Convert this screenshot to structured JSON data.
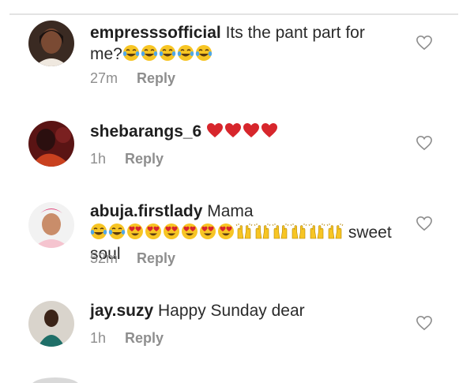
{
  "comments": [
    {
      "username": "empresssofficial",
      "text_before": " Its the pant part for me?",
      "text_after": "",
      "time": "27m",
      "reply_label": "Reply",
      "emojis": [
        "tears-of-joy",
        "tears-of-joy",
        "tears-of-joy",
        "tears-of-joy",
        "tears-of-joy"
      ]
    },
    {
      "username": "shebarangs_6",
      "text_before": "",
      "text_after": "",
      "time": "1h",
      "reply_label": "Reply",
      "emojis": [
        "red-heart",
        "red-heart",
        "red-heart",
        "red-heart"
      ]
    },
    {
      "username": "abuja.firstlady",
      "text_before": " Mama",
      "text_after": " sweet soul",
      "time": "52m",
      "reply_label": "Reply",
      "emojis": [
        "tears-of-joy",
        "tears-of-joy",
        "heart-eyes",
        "heart-eyes",
        "heart-eyes",
        "heart-eyes",
        "heart-eyes",
        "heart-eyes",
        "raising-hands",
        "raising-hands",
        "raising-hands",
        "raising-hands",
        "raising-hands",
        "raising-hands"
      ]
    },
    {
      "username": "jay.suzy",
      "text_before": " Happy Sunday dear",
      "text_after": "",
      "time": "1h",
      "reply_label": "Reply",
      "emojis": []
    }
  ],
  "colors": {
    "meta_gray": "#8e8e8e",
    "heart_outline": "#8e8e8e",
    "emoji_yellow": "#f7c524",
    "emoji_red": "#d7262c"
  },
  "icons": {
    "like": "heart-outline-icon"
  }
}
